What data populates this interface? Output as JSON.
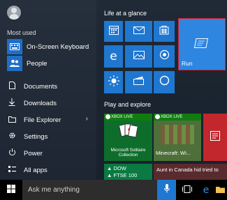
{
  "left": {
    "most_used_label": "Most used",
    "most_used": [
      {
        "label": "On-Screen Keyboard",
        "icon": "keyboard-icon"
      },
      {
        "label": "People",
        "icon": "people-icon"
      }
    ],
    "system": [
      {
        "label": "Documents",
        "icon": "document-icon"
      },
      {
        "label": "Downloads",
        "icon": "download-icon"
      },
      {
        "label": "File Explorer",
        "icon": "folder-icon"
      },
      {
        "label": "Settings",
        "icon": "gear-icon"
      },
      {
        "label": "Power",
        "icon": "power-icon"
      },
      {
        "label": "All apps",
        "icon": "all-apps-icon"
      }
    ]
  },
  "right": {
    "section1": "Life at a glance",
    "section2": "Play and explore",
    "run_label": "Run",
    "tiles2": {
      "xbox_live": "XBOX LIVE",
      "solitaire": "Microsoft Solitaire Collection",
      "minecraft": "Minecraft: Wi...",
      "dow": "▲ DOW",
      "ftse": "▲ FTSE 100",
      "news": "Aunt in Canada hid tried to"
    }
  },
  "taskbar": {
    "search_placeholder": "Ask me anything"
  },
  "colors": {
    "tile_blue": "#1f77d0",
    "run_border": "#e31f26",
    "xbox_green": "#107c10",
    "finance_green": "#0a7a42",
    "news_red": "#c1272d"
  }
}
